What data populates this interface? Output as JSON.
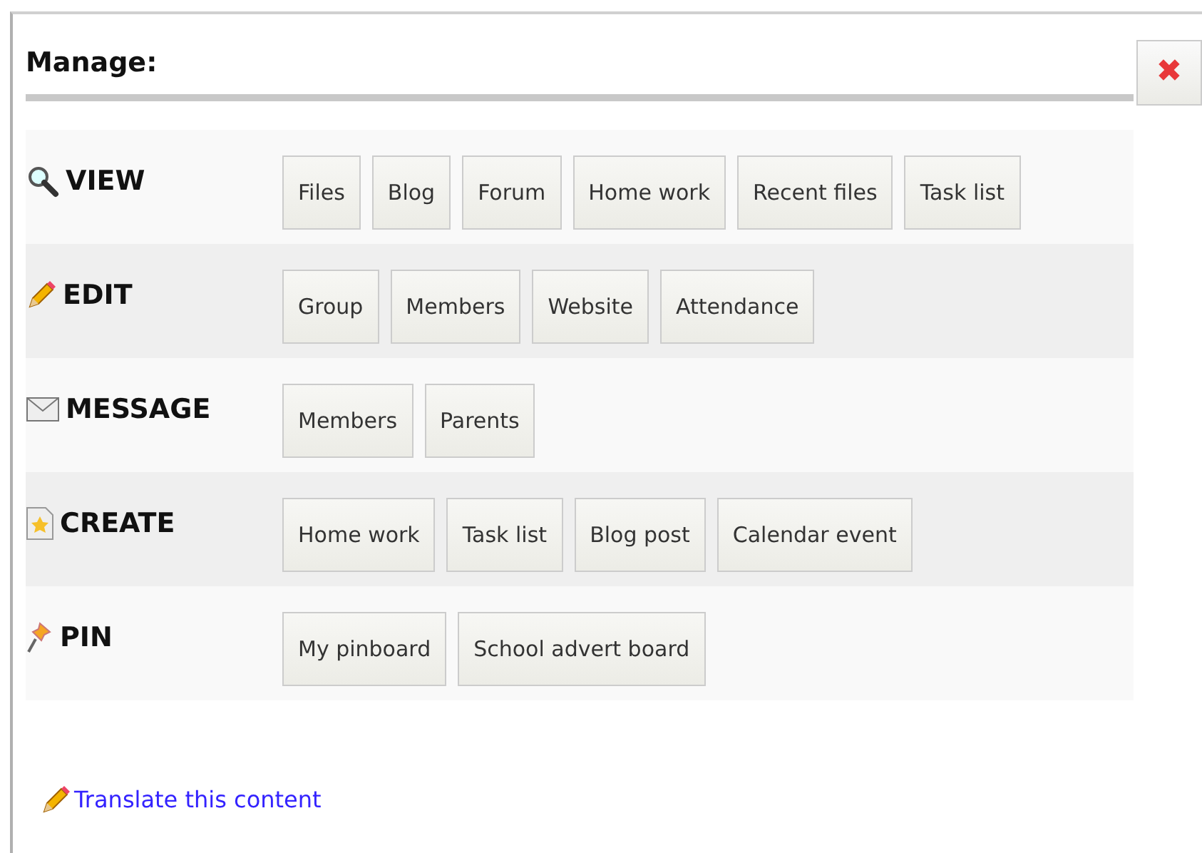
{
  "title": "Manage:",
  "close": {
    "label": "✖"
  },
  "sections": [
    {
      "label": "VIEW",
      "kind": "search",
      "buttons": [
        "Files",
        "Blog",
        "Forum",
        "Home work",
        "Recent files",
        "Task list"
      ]
    },
    {
      "label": "EDIT",
      "kind": "pencil",
      "buttons": [
        "Group",
        "Members",
        "Website",
        "Attendance"
      ]
    },
    {
      "label": "MESSAGE",
      "kind": "envelope",
      "buttons": [
        "Members",
        "Parents"
      ]
    },
    {
      "label": "CREATE",
      "kind": "star",
      "buttons": [
        "Home work",
        "Task list",
        "Blog post",
        "Calendar event"
      ]
    },
    {
      "label": "PIN",
      "kind": "pin",
      "buttons": [
        "My pinboard",
        "School advert board"
      ]
    }
  ],
  "link": {
    "label": "Translate this content",
    "kind": "pencil"
  }
}
